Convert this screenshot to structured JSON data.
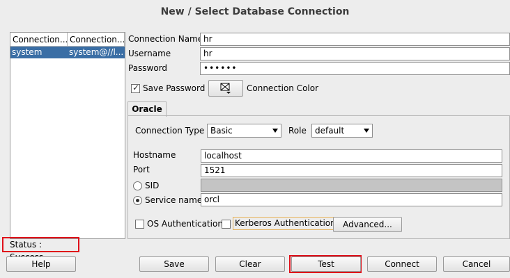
{
  "dialog": {
    "title": "New / Select Database Connection"
  },
  "connections": {
    "columns": [
      "Connection...",
      "Connection..."
    ],
    "rows": [
      {
        "name": "system",
        "details": "system@//l..."
      }
    ]
  },
  "form": {
    "connection_name_label": "Connection Name",
    "connection_name_value": "hr",
    "username_label": "Username",
    "username_value": "hr",
    "password_label": "Password",
    "password_value": "••••••",
    "save_password_label": "Save Password",
    "save_password_checked": true,
    "connection_color_label": "Connection Color"
  },
  "tabs": [
    {
      "label": "Oracle",
      "active": true
    }
  ],
  "oracle": {
    "connection_type_label": "Connection Type",
    "connection_type_value": "Basic",
    "role_label": "Role",
    "role_value": "default",
    "hostname_label": "Hostname",
    "hostname_value": "localhost",
    "port_label": "Port",
    "port_value": "1521",
    "sid_label": "SID",
    "sid_value": "",
    "service_name_label": "Service name",
    "service_name_value": "orcl",
    "service_selected": true,
    "os_auth_label": "OS Authentication",
    "kerberos_label": "Kerberos Authentication",
    "advanced_label": "Advanced..."
  },
  "status": {
    "text": "Status : Success",
    "highlight_color": "#e0101a"
  },
  "buttons": {
    "help": "Help",
    "save": "Save",
    "clear": "Clear",
    "test": "Test",
    "connect": "Connect",
    "cancel": "Cancel"
  },
  "colors": {
    "selection": "#3a6ea5",
    "highlight": "#e0101a",
    "background": "#ededed"
  }
}
